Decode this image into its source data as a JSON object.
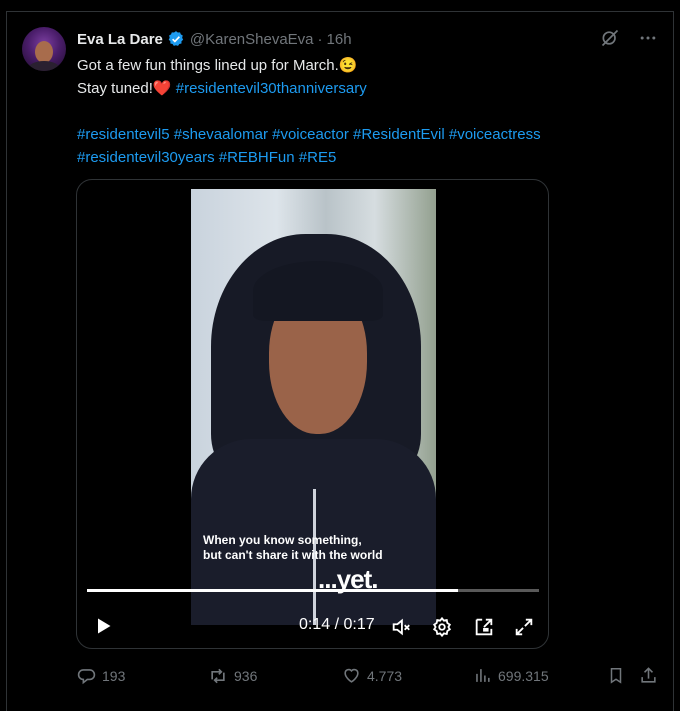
{
  "post": {
    "author_name": "Eva La Dare",
    "handle": "@KarenShevaEva",
    "separator": "·",
    "time": "16h",
    "line1": "Got a few fun things lined up for March.",
    "line1_emoji": "😉",
    "line2": "Stay tuned!",
    "line2_emoji": "❤️",
    "line2_tag": "#residentevil30thanniversary",
    "tags_line3": "#residentevil5 #shevaalomar #voiceactor #ResidentEvil #voiceactress",
    "tags_line4": "#residentevil30years #REBHFun #RE5"
  },
  "video": {
    "caption_line1": "When you know something,",
    "caption_line2": "but can't share it with the world",
    "caption_big": "...yet.",
    "time_display": "0:14 / 0:17",
    "progress": 0.82
  },
  "actions": {
    "replies": "193",
    "reposts": "936",
    "likes": "4.773",
    "views": "699.315"
  },
  "colors": {
    "accent": "#1d9bf0",
    "muted": "#71767b",
    "like_heart": "#f91880"
  },
  "icons": {
    "verified": "verified-badge-icon",
    "grok": "grok-icon",
    "more": "more-icon",
    "play": "play-icon",
    "mute": "volume-muted-icon",
    "settings": "gear-icon",
    "pip": "picture-in-picture-icon",
    "fullscreen": "fullscreen-icon",
    "reply": "reply-icon",
    "repost": "repost-icon",
    "like": "heart-icon",
    "views": "views-icon",
    "bookmark": "bookmark-icon",
    "share": "share-icon"
  }
}
